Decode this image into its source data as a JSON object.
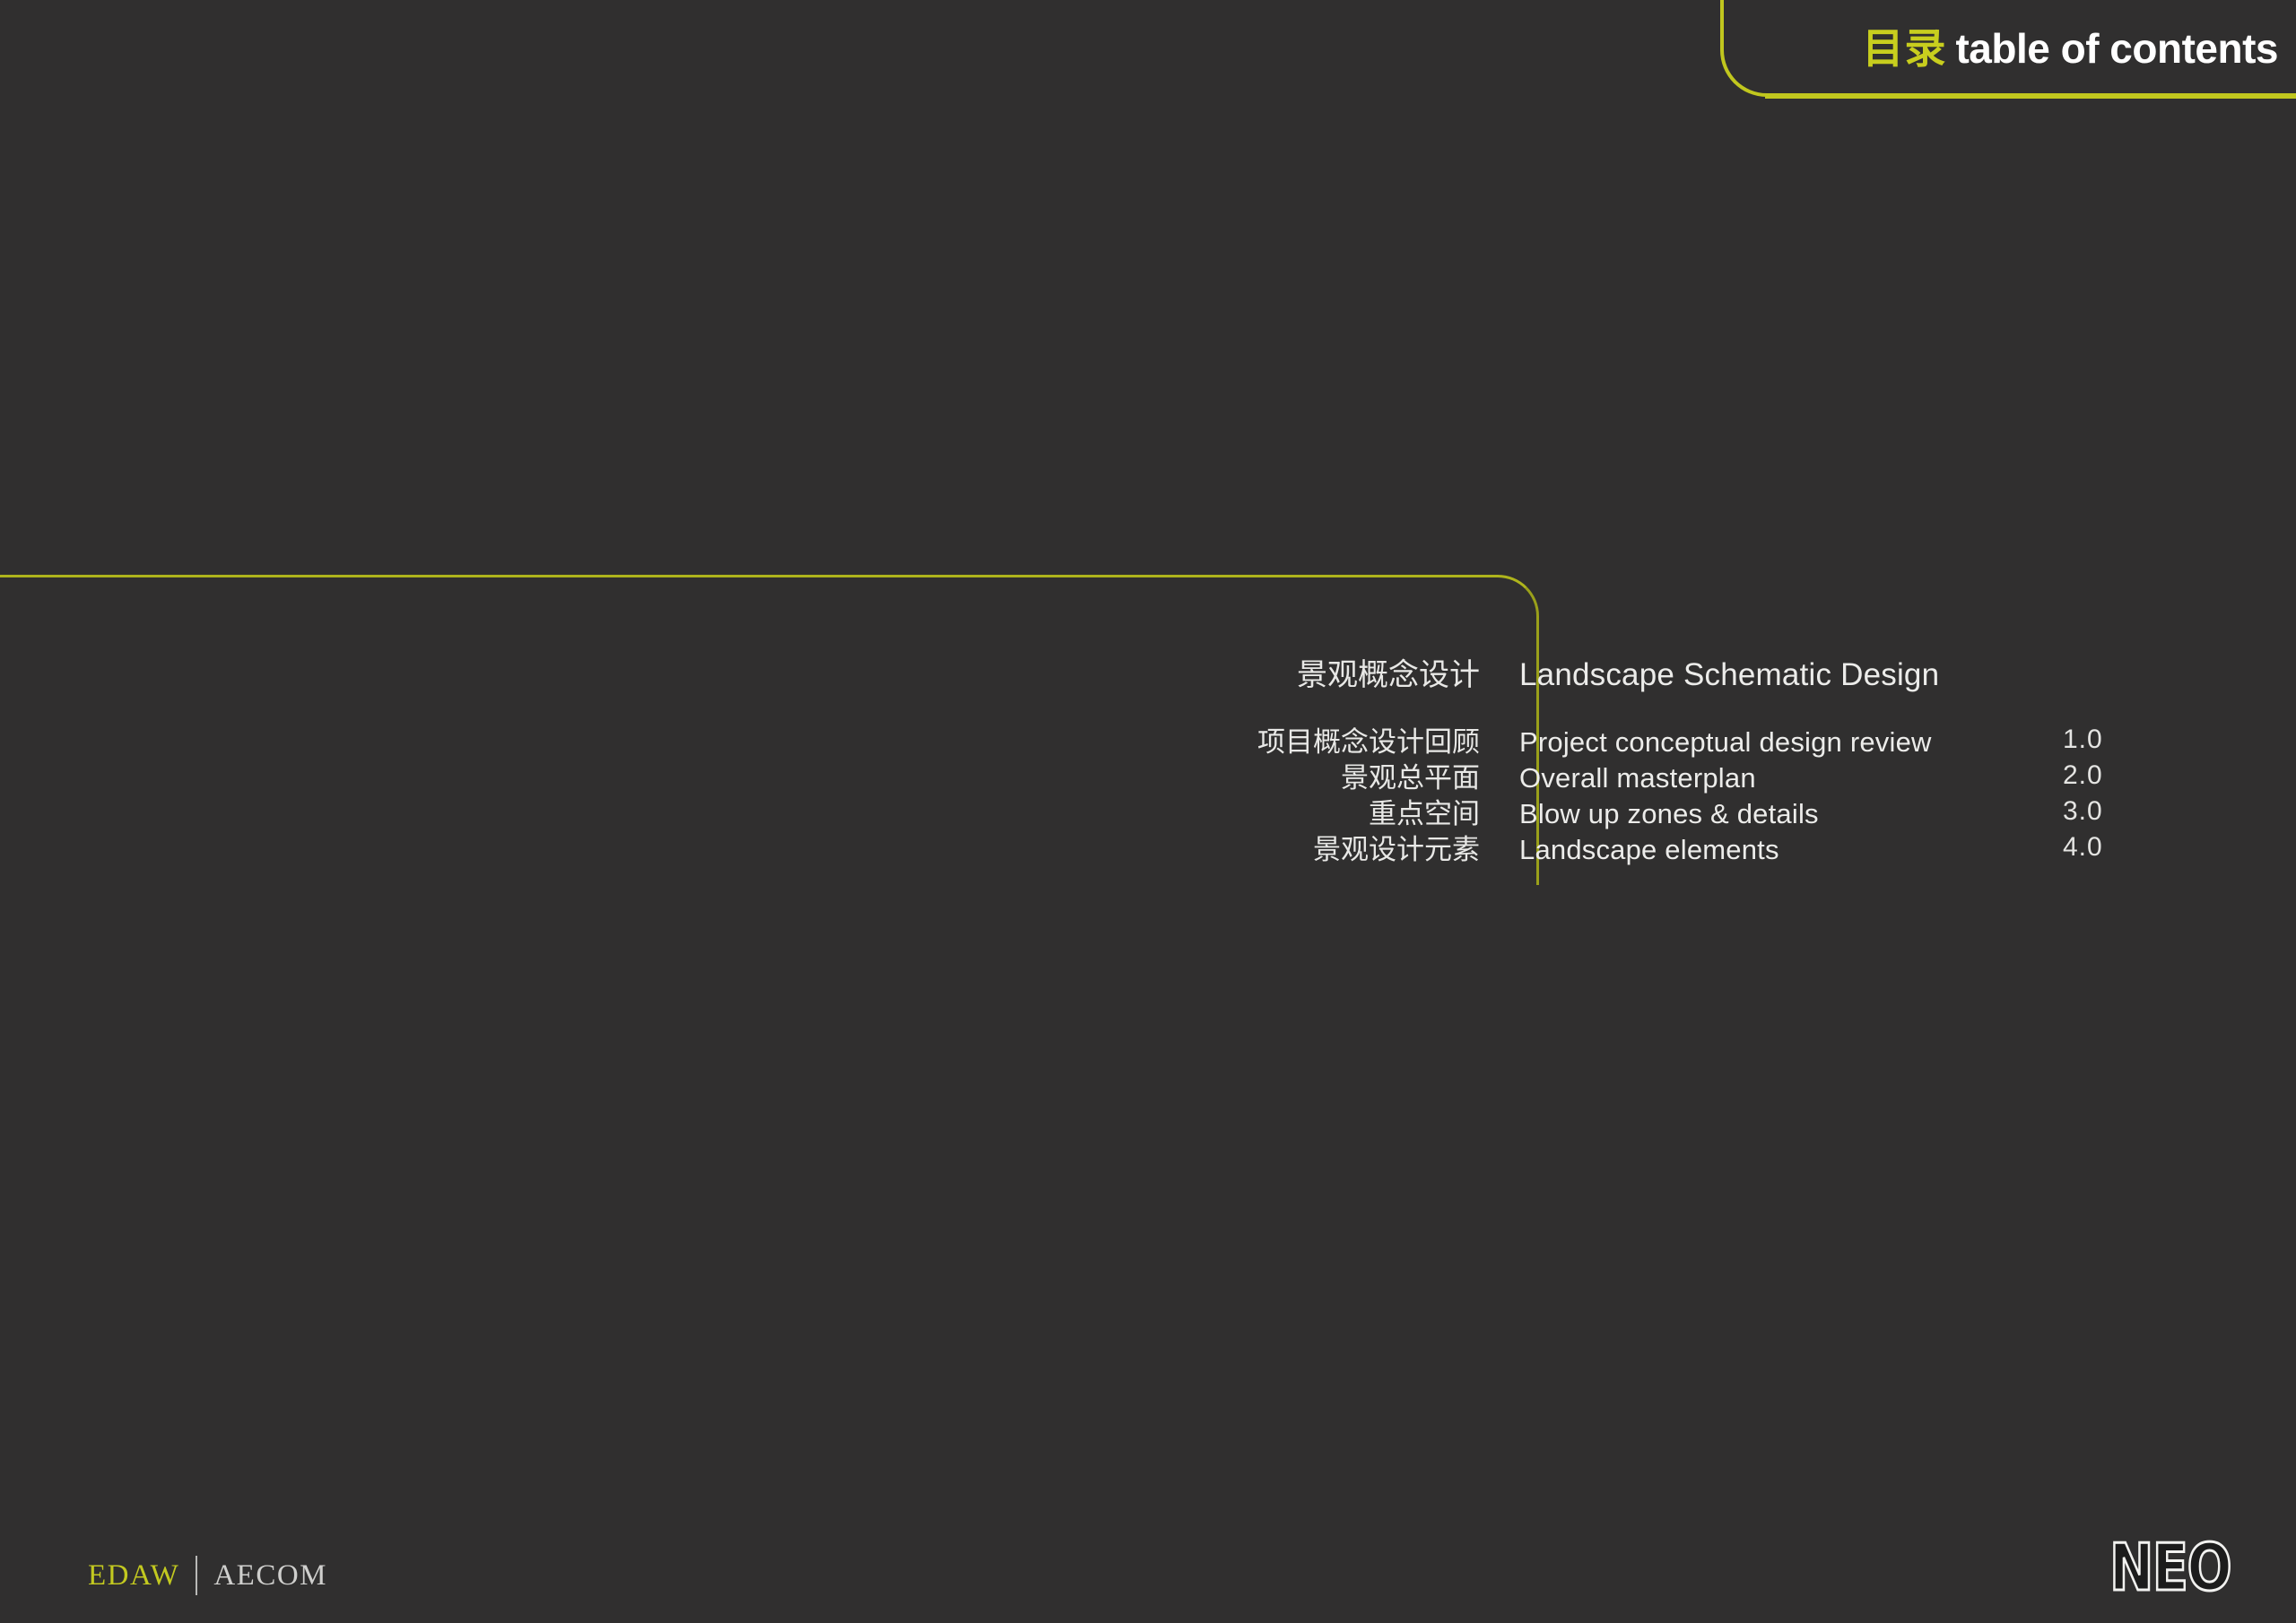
{
  "colors": {
    "background": "#302f2f",
    "accent": "#c8ce1e",
    "rule": "#aeb41c",
    "text": "#ececea"
  },
  "header": {
    "title_cjk": "目录",
    "title_en": "table of contents"
  },
  "content": {
    "heading": {
      "cn": "景观概念设计",
      "en": "Landscape Schematic Design"
    },
    "items": [
      {
        "cn": "项目概念设计回顾",
        "en": "Project conceptual design review",
        "number": "1.0"
      },
      {
        "cn": "景观总平面",
        "en": "Overall masterplan",
        "number": "2.0"
      },
      {
        "cn": "重点空间",
        "en": "Blow up zones & details",
        "number": "3.0"
      },
      {
        "cn": "景观设计元素",
        "en": "Landscape elements",
        "number": "4.0"
      }
    ]
  },
  "footer": {
    "edaw": "EDAW",
    "aecom": "AECOM",
    "neo": "NEO"
  }
}
